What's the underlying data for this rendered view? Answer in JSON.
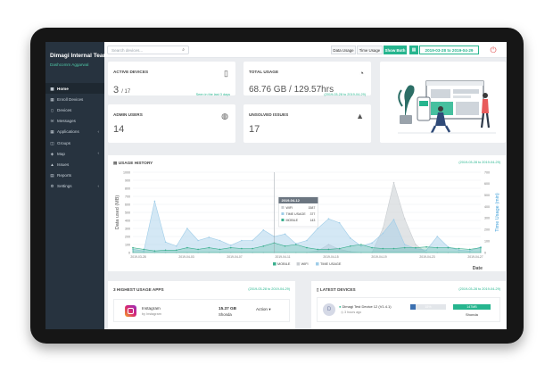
{
  "colors": {
    "accent": "#26b58e",
    "sidebar": "#27333f",
    "mobile": "#3aaf8e",
    "wifi": "#c9cdd1",
    "time": "#9fcde8"
  },
  "sidebar": {
    "org": "Dimagi Internal Team",
    "org_chevron": "▾",
    "org_sub": "Dashcomm Aggarwal",
    "items": [
      {
        "label": "Home",
        "icon": "home-icon",
        "glyph": "▦",
        "chevron": ""
      },
      {
        "label": "Enroll Devices",
        "icon": "enroll-icon",
        "glyph": "▦",
        "chevron": ""
      },
      {
        "label": "Devices",
        "icon": "devices-icon",
        "glyph": "▯",
        "chevron": ""
      },
      {
        "label": "Messages",
        "icon": "messages-icon",
        "glyph": "✉",
        "chevron": ""
      },
      {
        "label": "Applications",
        "icon": "applications-icon",
        "glyph": "▦",
        "chevron": "‹"
      },
      {
        "label": "Groups",
        "icon": "groups-icon",
        "glyph": "◫",
        "chevron": ""
      },
      {
        "label": "Map",
        "icon": "map-icon",
        "glyph": "◈",
        "chevron": "‹"
      },
      {
        "label": "Issues",
        "icon": "issues-icon",
        "glyph": "▲",
        "chevron": ""
      },
      {
        "label": "Reports",
        "icon": "reports-icon",
        "glyph": "▤",
        "chevron": ""
      },
      {
        "label": "Settings",
        "icon": "settings-icon",
        "glyph": "⚙",
        "chevron": "‹"
      }
    ]
  },
  "topbar": {
    "search_placeholder": "Search devices...",
    "btn_data": "Data Usage",
    "btn_time": "Time Usage",
    "btn_both": "Show Both",
    "date_range": "2019-03-28 to 2019-04-29"
  },
  "cards": {
    "active": {
      "label": "ACTIVE DEVICES",
      "value": "3",
      "total": "/ 17",
      "note": "Seen in the last 3 days"
    },
    "usage": {
      "label": "TOTAL USAGE",
      "value": "68.76 GB / 129.57hrs",
      "note": "(2019-03-28 to 2019-04-29)"
    },
    "admins": {
      "label": "ADMIN USERS",
      "value": "14"
    },
    "issues": {
      "label": "UNSOLVED ISSUES",
      "value": "17"
    }
  },
  "usage_history": {
    "title": "USAGE HISTORY",
    "date": "(2019-03-28 to 2019-04-29)",
    "legend_mobile": "MOBILE",
    "legend_wifi": "WIFI",
    "legend_time": "TIME USAGE",
    "tooltip_title": "2019-04-12",
    "tooltip_rows": [
      {
        "label": "WIFI",
        "value": "1587"
      },
      {
        "label": "TIME USAGE",
        "value": "377"
      },
      {
        "label": "MOBILE",
        "value": "143"
      }
    ]
  },
  "chart_data": {
    "type": "area",
    "xlabel": "Date",
    "ylabel": "Data used (MB)",
    "y2label": "Time Usage (min)",
    "ylim": [
      0,
      1000
    ],
    "y2lim": [
      0,
      700
    ],
    "grid": true,
    "legend": "bottom",
    "yticks": [
      "1000",
      "900",
      "800",
      "700",
      "600",
      "500",
      "400",
      "300",
      "200",
      "100",
      "0"
    ],
    "y2ticks": [
      "700",
      "600",
      "500",
      "400",
      "300",
      "200",
      "100",
      "0"
    ],
    "xticks": [
      "2019-03-28",
      "2019-04-03",
      "2019-04-07",
      "2019-04-11",
      "2019-04-15",
      "2019-04-19",
      "2019-04-23",
      "2019-04-27"
    ],
    "series": [
      {
        "name": "WIFI",
        "values": [
          0,
          0,
          0,
          0,
          0,
          0,
          0,
          0,
          0,
          0,
          0,
          0,
          0,
          0,
          0,
          0,
          0,
          20,
          100,
          40,
          10,
          0,
          0,
          300,
          870,
          420,
          100,
          0,
          0,
          0,
          0,
          0,
          0
        ]
      },
      {
        "name": "TIME USAGE",
        "values": [
          40,
          20,
          640,
          130,
          80,
          300,
          150,
          190,
          150,
          90,
          150,
          150,
          280,
          200,
          230,
          110,
          150,
          300,
          420,
          370,
          180,
          80,
          120,
          240,
          410,
          100,
          50,
          30,
          200,
          70,
          30,
          20,
          70
        ]
      },
      {
        "name": "MOBILE",
        "values": [
          60,
          40,
          20,
          30,
          30,
          60,
          40,
          60,
          40,
          60,
          50,
          50,
          80,
          120,
          80,
          100,
          60,
          40,
          40,
          50,
          80,
          100,
          60,
          50,
          50,
          60,
          60,
          70,
          60,
          60,
          50,
          40,
          60
        ]
      }
    ]
  },
  "bottom": {
    "apps": {
      "title": "3 HIGHEST USAGE APPS",
      "date": "(2019-03-28 to 2019-04-29)",
      "app_name": "Instagram",
      "app_sub": "by Instagram",
      "app_size": "15.37 GB",
      "app_user": "Shonda",
      "action": "Action ▾"
    },
    "devices": {
      "title": "LATEST DEVICES",
      "date": "(2019-03-28 to 2019-04-29)",
      "device_name": "Dimagi Test Device 12 (V1.4.1)",
      "device_time": "3 hours ago",
      "avatar_letter": "D",
      "bar1": "15%",
      "bar2": "147MB",
      "user": "Shonda"
    }
  }
}
